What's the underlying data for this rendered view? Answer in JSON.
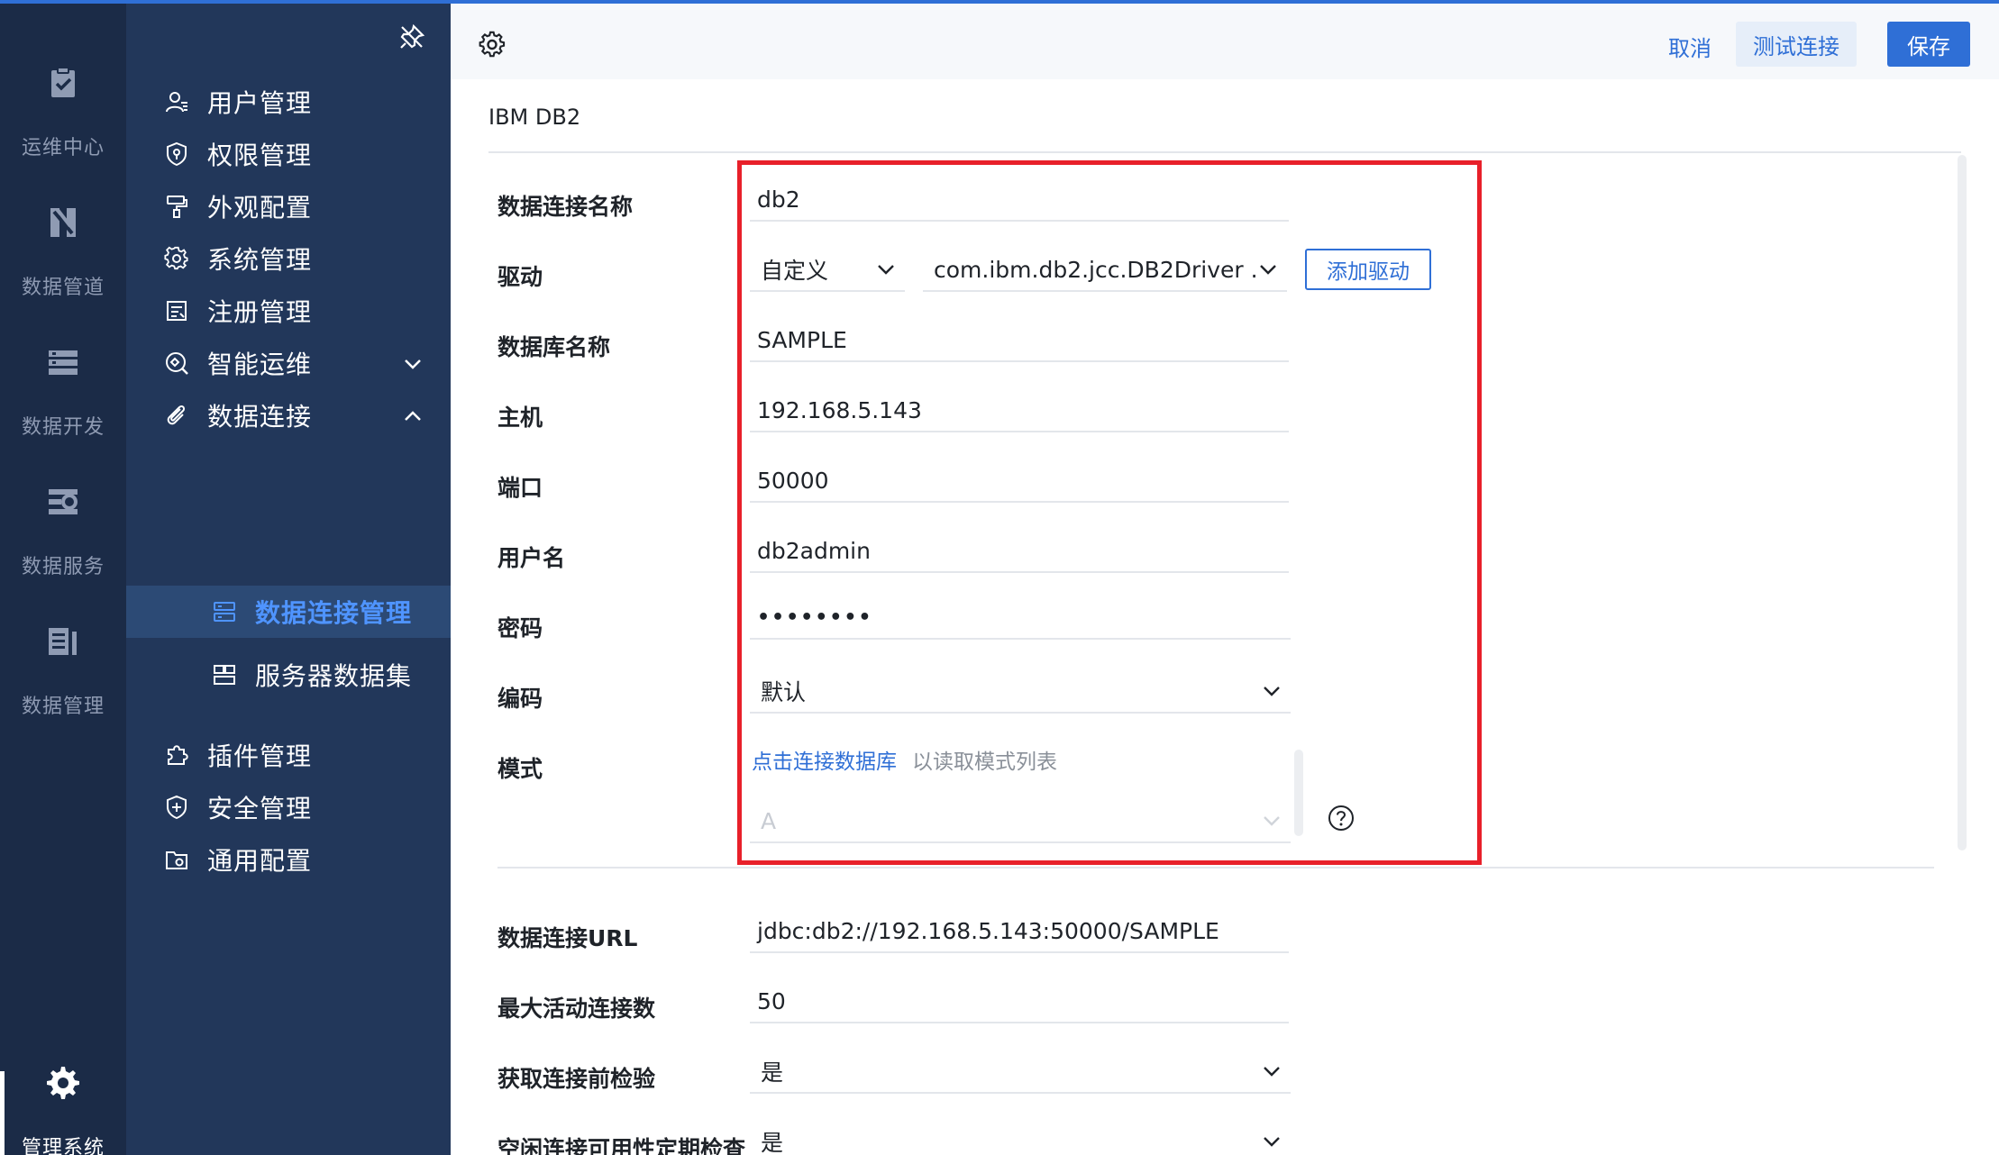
{
  "rail": {
    "items": [
      {
        "label": "运维中心",
        "icon": "clipboard-check-icon"
      },
      {
        "label": "数据管道",
        "icon": "data-pipeline-icon"
      },
      {
        "label": "数据开发",
        "icon": "data-dev-icon"
      },
      {
        "label": "数据服务",
        "icon": "data-service-icon"
      },
      {
        "label": "数据管理",
        "icon": "data-manage-icon"
      },
      {
        "label": "管理系统",
        "icon": "gear-icon"
      }
    ]
  },
  "menu": {
    "items": [
      {
        "label": "用户管理",
        "icon": "user-icon"
      },
      {
        "label": "权限管理",
        "icon": "permission-icon"
      },
      {
        "label": "外观配置",
        "icon": "paint-roller-icon"
      },
      {
        "label": "系统管理",
        "icon": "gear-icon"
      },
      {
        "label": "注册管理",
        "icon": "register-icon"
      },
      {
        "label": "智能运维",
        "icon": "smart-ops-icon"
      },
      {
        "label": "数据连接",
        "icon": "paperclip-icon"
      },
      {
        "label": "插件管理",
        "icon": "puzzle-icon"
      },
      {
        "label": "安全管理",
        "icon": "shield-icon"
      },
      {
        "label": "通用配置",
        "icon": "folder-settings-icon"
      }
    ],
    "sub_items": [
      {
        "label": "数据连接管理",
        "icon": "connection-manage-icon"
      },
      {
        "label": "服务器数据集",
        "icon": "server-dataset-icon"
      }
    ]
  },
  "toolbar": {
    "cancel_label": "取消",
    "test_label": "测试连接",
    "save_label": "保存"
  },
  "connection_type": "IBM DB2",
  "form": {
    "name": {
      "label": "数据连接名称",
      "value": "db2"
    },
    "driver": {
      "label": "驱动",
      "mode": "自定义",
      "class": "com.ibm.db2.jcc.DB2Driver ...",
      "add_label": "添加驱动"
    },
    "database": {
      "label": "数据库名称",
      "value": "SAMPLE"
    },
    "host": {
      "label": "主机",
      "value": "192.168.5.143"
    },
    "port": {
      "label": "端口",
      "value": "50000"
    },
    "username": {
      "label": "用户名",
      "value": "db2admin"
    },
    "password": {
      "label": "密码",
      "value": "••••••••"
    },
    "encoding": {
      "label": "编码",
      "value": "默认"
    },
    "schema": {
      "label": "模式",
      "link": "点击连接数据库",
      "hint": "以读取模式列表",
      "value": "A"
    },
    "url": {
      "label": "数据连接URL",
      "value": "jdbc:db2://192.168.5.143:50000/SAMPLE"
    },
    "max_active": {
      "label": "最大活动连接数",
      "value": "50"
    },
    "test_on_borrow": {
      "label": "获取连接前检验",
      "value": "是"
    },
    "idle_check": {
      "label": "空闲连接可用性定期检查",
      "value": "是"
    }
  },
  "colors": {
    "accent": "#2f6fd6",
    "rail_bg": "#1b2b47",
    "menu_bg": "#22375a",
    "highlight": "#e8202a"
  }
}
